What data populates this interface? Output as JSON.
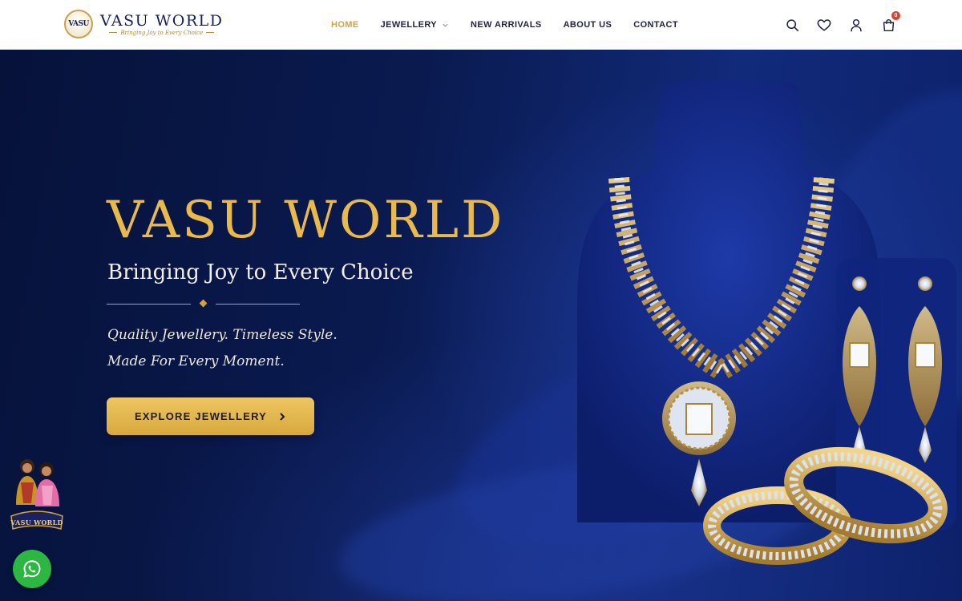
{
  "header": {
    "logo": {
      "name": "VASU WORLD",
      "tagline": "Bringing Joy to Every Choice",
      "mark_text": "VASU"
    },
    "nav": [
      {
        "label": "HOME",
        "active": true
      },
      {
        "label": "JEWELLERY",
        "dropdown": true
      },
      {
        "label": "NEW ARRIVALS"
      },
      {
        "label": "ABOUT US"
      },
      {
        "label": "CONTACT"
      }
    ],
    "icons": [
      "search-icon",
      "heart-icon",
      "user-icon",
      "cart-icon"
    ],
    "cart_count": "0"
  },
  "hero": {
    "title": "VASU WORLD",
    "subtitle": "Bringing Joy to Every Choice",
    "line1": "Quality Jewellery. Timeless Style.",
    "line2": "Made For Every Moment.",
    "cta_label": "EXPLORE JEWELLERY"
  },
  "floating": {
    "badge_text": "VASU WORLD"
  },
  "colors": {
    "gold": "#d4a23c",
    "navy": "#14205a",
    "hero_bg": "#0a1a4f",
    "whatsapp": "#2bb742",
    "badge": "#e0422d"
  }
}
